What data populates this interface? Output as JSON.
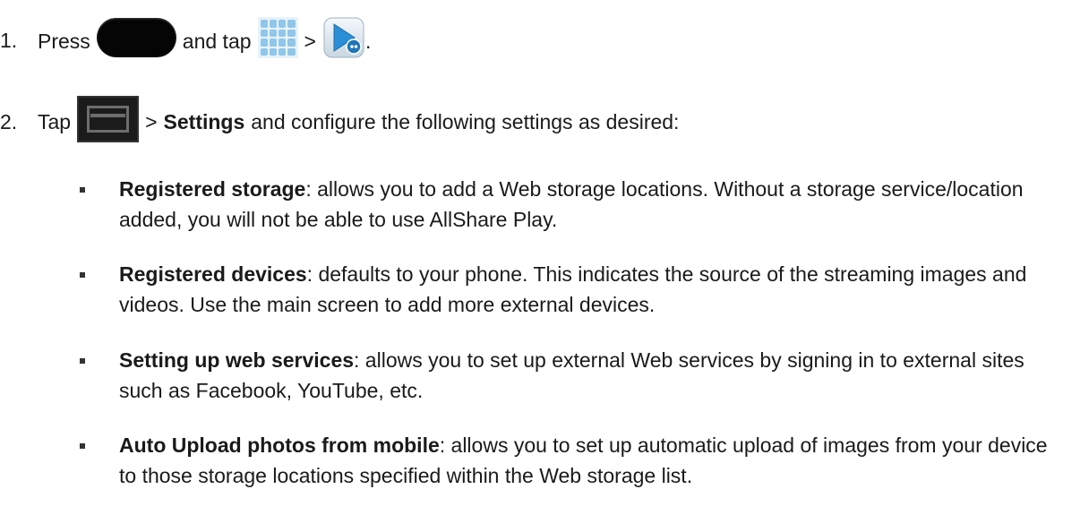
{
  "steps": [
    {
      "number": "1.",
      "press": "Press",
      "and_tap": "and tap",
      "sep": ">",
      "end": ".",
      "icons": [
        "home-key-icon",
        "apps-icon",
        "allshare-play-icon"
      ]
    },
    {
      "number": "2.",
      "tap": "Tap",
      "sep": ">",
      "settings": "Settings",
      "rest": "and configure the following settings as desired:",
      "icons": [
        "menu-key-icon"
      ]
    }
  ],
  "bullets": [
    {
      "title": "Registered storage",
      "desc": ": allows you to add a Web storage locations. Without a storage service/location added, you will not be able to use AllShare Play."
    },
    {
      "title": "Registered devices",
      "desc": ": defaults to your phone. This indicates the source of the streaming images and videos. Use the main screen to add more external devices."
    },
    {
      "title": "Setting up web services",
      "desc": ": allows you to set up external Web services by signing in to external sites such as Facebook, YouTube, etc."
    },
    {
      "title": "Auto Upload photos from mobile",
      "desc": ": allows you to set up automatic upload of images from your device to those storage locations specified within the Web storage list."
    }
  ],
  "colors": {
    "text": "#1a1a1a",
    "apps_icon_tile": "#8fc6ea",
    "allshare_blue": "#2a8fd6"
  }
}
